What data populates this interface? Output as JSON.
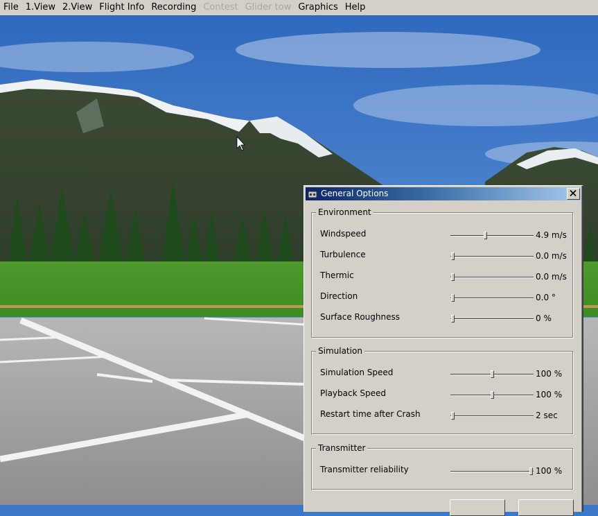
{
  "menu": [
    {
      "label": "File",
      "enabled": true
    },
    {
      "label": "1.View",
      "enabled": true
    },
    {
      "label": "2.View",
      "enabled": true
    },
    {
      "label": "Flight Info",
      "enabled": true
    },
    {
      "label": "Recording",
      "enabled": true
    },
    {
      "label": "Contest",
      "enabled": false
    },
    {
      "label": "Glider tow",
      "enabled": false
    },
    {
      "label": "Graphics",
      "enabled": true
    },
    {
      "label": "Help",
      "enabled": true
    }
  ],
  "dialog": {
    "title": "General Options",
    "groups": [
      {
        "legend": "Environment",
        "rows": [
          {
            "label": "Windspeed",
            "value": "4.9 m/s",
            "level": 0.42
          },
          {
            "label": "Turbulence",
            "value": "0.0 m/s",
            "level": 0.0
          },
          {
            "label": "Thermic",
            "value": "0.0 m/s",
            "level": 0.0
          },
          {
            "label": "Direction",
            "value": "0.0 °",
            "level": 0.0
          },
          {
            "label": "Surface Roughness",
            "value": "0 %",
            "level": 0.0
          }
        ]
      },
      {
        "legend": "Simulation",
        "rows": [
          {
            "label": "Simulation Speed",
            "value": "100 %",
            "level": 0.5
          },
          {
            "label": "Playback Speed",
            "value": "100 %",
            "level": 0.5
          },
          {
            "label": "Restart time after Crash",
            "value": "2 sec",
            "level": 0.0
          }
        ]
      },
      {
        "legend": "Transmitter",
        "rows": [
          {
            "label": "Transmitter reliability",
            "value": "100 %",
            "level": 1.0
          }
        ]
      }
    ]
  },
  "colors": {
    "sky": "#3d78c8",
    "titlebar": "#0a246a",
    "dialog": "#d4d0c8"
  }
}
